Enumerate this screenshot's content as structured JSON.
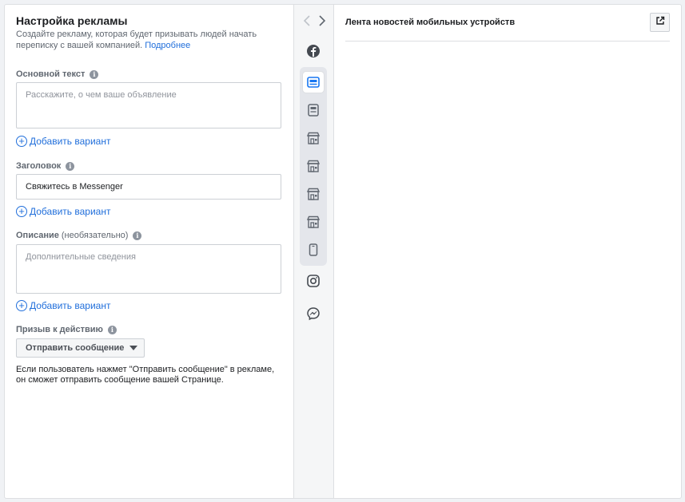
{
  "editor": {
    "title": "Настройка рекламы",
    "subtitle": "Создайте рекламу, которая будет призывать людей начать переписку с вашей компанией.",
    "learn_more": "Подробнее",
    "primary_text": {
      "label": "Основной текст",
      "placeholder": "Расскажите, о чем ваше объявление"
    },
    "headline": {
      "label": "Заголовок",
      "value": "Свяжитесь в Messenger"
    },
    "description": {
      "label": "Описание",
      "optional": "(необязательно)",
      "placeholder": "Дополнительные сведения"
    },
    "add_variant": "Добавить вариант",
    "cta": {
      "label": "Призыв к действию",
      "selected": "Отправить сообщение",
      "note": "Если пользователь нажмет \"Отправить сообщение\" в рекламе, он сможет отправить сообщение вашей Странице."
    }
  },
  "placements": {
    "icons": [
      "chevron-left-icon",
      "chevron-right-icon",
      "facebook-icon",
      "feed-icon",
      "instant-article-icon",
      "marketplace-icon",
      "marketplace-icon",
      "marketplace-icon",
      "marketplace-icon",
      "stories-icon",
      "instagram-icon",
      "messenger-icon"
    ],
    "selected_index": 1
  },
  "preview": {
    "title": "Лента новостей мобильных устройств",
    "open_icon": "external-link-icon"
  },
  "colors": {
    "link": "#216fdb",
    "icon": "#606770",
    "selected_icon": "#1877f2"
  }
}
